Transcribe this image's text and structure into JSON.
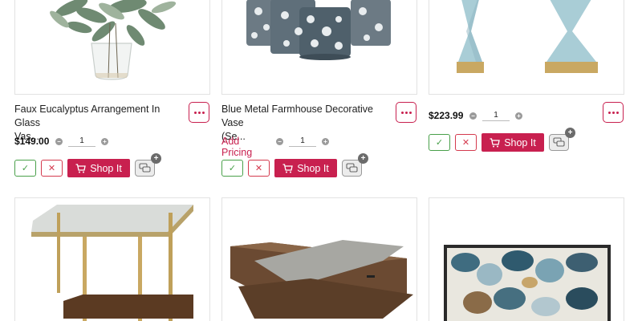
{
  "products": [
    {
      "title_line1": "Faux Eucalyptus Arrangement In Glass",
      "title_line2": "Vas...",
      "price": "$149.00",
      "qty": "1",
      "shop_label": "Shop It"
    },
    {
      "title_line1": "Blue Metal Farmhouse Decorative Vase",
      "title_line2": "(Se...",
      "pricing_link": "Add Pricing",
      "qty": "1",
      "shop_label": "Shop It"
    },
    {
      "price": "$223.99",
      "qty": "1",
      "shop_label": "Shop It"
    }
  ],
  "icons": {
    "more": "more-options-icon",
    "approve": "check-icon",
    "reject": "close-icon",
    "cart": "cart-icon",
    "comment": "comment-icon",
    "comment_add": "plus-icon"
  },
  "colors": {
    "accent": "#c8204f",
    "approve": "#49a04a",
    "reject": "#d43a4e",
    "border": "#e2e2e2"
  },
  "glyphs": {
    "check": "✓",
    "x": "✕",
    "plus": "+",
    "minus": "−"
  }
}
